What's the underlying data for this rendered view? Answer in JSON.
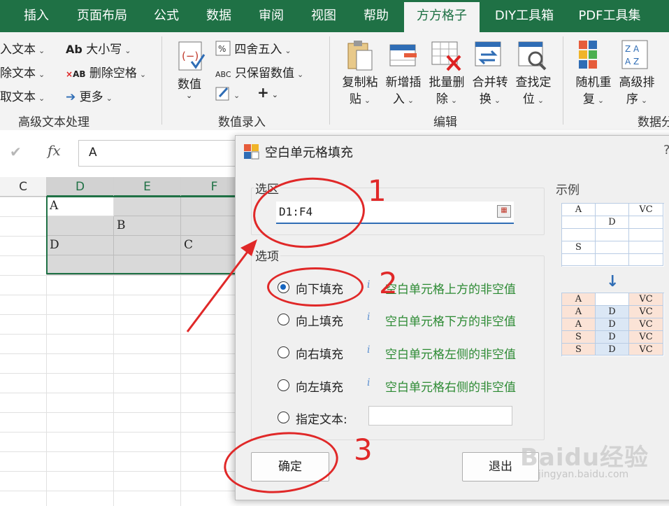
{
  "tabs": [
    {
      "label": "插入"
    },
    {
      "label": "页面布局"
    },
    {
      "label": "公式"
    },
    {
      "label": "数据"
    },
    {
      "label": "审阅"
    },
    {
      "label": "视图"
    },
    {
      "label": "帮助"
    },
    {
      "label": "方方格子"
    },
    {
      "label": "DIY工具箱"
    },
    {
      "label": "PDF工具集"
    }
  ],
  "active_tab": "方方格子",
  "ribbon": {
    "text_group": {
      "items": [
        "入文本",
        "除文本",
        "取文本"
      ],
      "items2": [
        "大小写",
        "删除空格",
        "更多"
      ],
      "icon_ab": "Ab",
      "icon_xab": "AB",
      "label": "高级文本处理"
    },
    "value_group": {
      "big_label": "数值",
      "items": [
        "四舍五入",
        "只保留数值"
      ],
      "abc_icon": "ABC",
      "plus": "+",
      "label": "数值录入"
    },
    "edit_group": {
      "buttons": [
        {
          "line1": "复制粘",
          "line2": "贴"
        },
        {
          "line1": "新增插",
          "line2": "入"
        },
        {
          "line1": "批量删",
          "line2": "除"
        },
        {
          "line1": "合并转",
          "line2": "换"
        },
        {
          "line1": "查找定",
          "line2": "位"
        }
      ],
      "label": "编辑"
    },
    "data_group": {
      "buttons": [
        {
          "line1": "随机重",
          "line2": "复"
        },
        {
          "line1": "高级排",
          "line2": "序"
        }
      ],
      "label": "数据分"
    }
  },
  "formula_bar": {
    "check": "✔",
    "fx": "fx",
    "value": "A"
  },
  "sheet": {
    "columns": [
      "C",
      "D",
      "E",
      "F"
    ],
    "cells": [
      [
        "A",
        "",
        ""
      ],
      [
        "",
        "B",
        ""
      ],
      [
        "D",
        "",
        "C"
      ],
      [
        "",
        "",
        ""
      ]
    ]
  },
  "dialog": {
    "title": "空白单元格填充",
    "help": "?",
    "range_section": "选区",
    "range_value": "D1:F4",
    "options_section": "选项",
    "options": [
      {
        "label": "向下填充",
        "desc": "空白单元格上方的非空值",
        "selected": true
      },
      {
        "label": "向上填充",
        "desc": "空白单元格下方的非空值",
        "selected": false
      },
      {
        "label": "向右填充",
        "desc": "空白单元格左侧的非空值",
        "selected": false
      },
      {
        "label": "向左填充",
        "desc": "空白单元格右侧的非空值",
        "selected": false
      }
    ],
    "info_glyph": "i",
    "custom_label": "指定文本:",
    "custom_value": "",
    "example_label": "示例",
    "example_before": [
      [
        "A",
        "",
        "VC"
      ],
      [
        "",
        "D",
        ""
      ],
      [
        "",
        "",
        ""
      ],
      [
        "S",
        "",
        ""
      ],
      [
        "",
        "",
        ""
      ]
    ],
    "example_after": [
      [
        "A",
        "",
        "VC"
      ],
      [
        "A",
        "D",
        "VC"
      ],
      [
        "A",
        "D",
        "VC"
      ],
      [
        "S",
        "D",
        "VC"
      ],
      [
        "S",
        "D",
        "VC"
      ]
    ],
    "arrow": "↓",
    "ok_label": "确定",
    "exit_label": "退出"
  },
  "annotations": [
    "1",
    "2",
    "3"
  ],
  "watermark": {
    "text": "Baidu经验",
    "url": "jingyan.baidu.com"
  }
}
